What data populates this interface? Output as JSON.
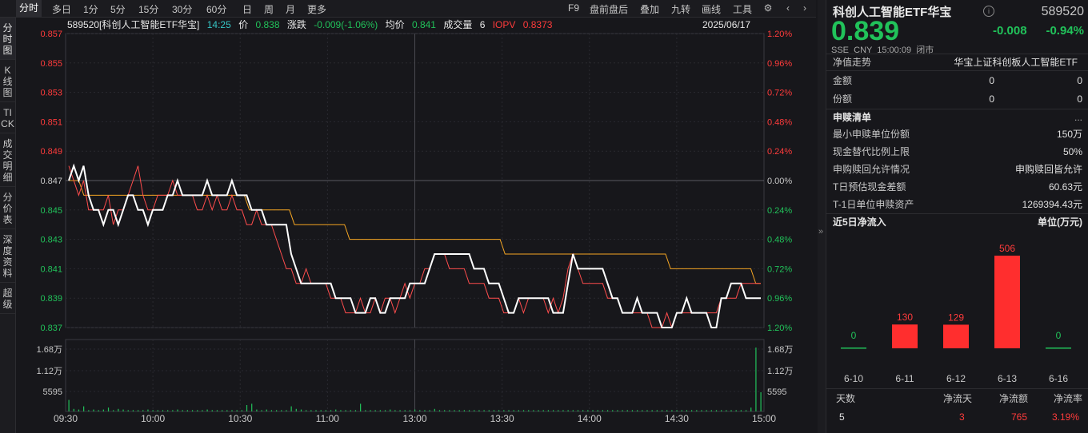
{
  "toolbar": {
    "tabs": [
      "分时",
      "多日",
      "1分",
      "5分",
      "15分",
      "30分",
      "60分",
      "日",
      "周",
      "月",
      "更多"
    ],
    "active_tab": "分时",
    "right_items": [
      "F9",
      "盘前盘后",
      "叠加",
      "九转",
      "画线",
      "工具"
    ]
  },
  "side_tabs": [
    "分时图",
    "K线图",
    "TICK",
    "成交明细",
    "分价表",
    "深度资料",
    "超级"
  ],
  "info": {
    "code_name": "589520[科创人工智能ETF华宝]",
    "time": "14:25",
    "price_label": "价",
    "price": "0.838",
    "change_label": "涨跌",
    "change": "-0.009(-1.06%)",
    "avg_label": "均价",
    "avg": "0.841",
    "volume_label": "成交量",
    "volume": "6",
    "iopv_label": "IOPV",
    "iopv": "0.8373",
    "date": "2025/06/17"
  },
  "chart_data": {
    "type": "line",
    "prev_close": 0.847,
    "x_ticks": [
      "09:30",
      "10:00",
      "10:30",
      "11:00",
      "13:00",
      "13:30",
      "14:00",
      "14:30",
      "15:00"
    ],
    "y_ticks_left": [
      "0.857",
      "0.855",
      "0.853",
      "0.851",
      "0.849",
      "0.847",
      "0.845",
      "0.843",
      "0.841",
      "0.839",
      "0.837"
    ],
    "y_ticks_right": [
      "1.20%",
      "0.96%",
      "0.72%",
      "0.48%",
      "0.24%",
      "0.00%",
      "0.24%",
      "0.48%",
      "0.72%",
      "0.96%",
      "1.20%"
    ],
    "ylim": [
      0.837,
      0.857
    ],
    "vol_ticks_left": [
      "1.68万",
      "1.12万",
      "5595"
    ],
    "vol_ticks_right": [
      "1.68万",
      "1.12万",
      "5595"
    ],
    "series": [
      {
        "name": "价",
        "color": "#ffffff",
        "values": [
          0.847,
          0.848,
          0.847,
          0.848,
          0.846,
          0.845,
          0.845,
          0.844,
          0.845,
          0.845,
          0.844,
          0.845,
          0.846,
          0.846,
          0.845,
          0.845,
          0.844,
          0.845,
          0.845,
          0.845,
          0.846,
          0.846,
          0.847,
          0.846,
          0.846,
          0.846,
          0.846,
          0.846,
          0.847,
          0.846,
          0.846,
          0.846,
          0.846,
          0.847,
          0.846,
          0.846,
          0.846,
          0.845,
          0.845,
          0.845,
          0.844,
          0.844,
          0.844,
          0.844,
          0.844,
          0.842,
          0.841,
          0.84,
          0.84,
          0.84,
          0.84,
          0.84,
          0.84,
          0.84,
          0.839,
          0.839,
          0.839,
          0.839,
          0.838,
          0.838,
          0.838,
          0.839,
          0.839,
          0.838,
          0.838,
          0.839,
          0.839,
          0.839,
          0.839,
          0.84,
          0.84,
          0.84,
          0.84,
          0.841,
          0.842,
          0.842,
          0.842,
          0.842,
          0.842,
          0.842,
          0.842,
          0.842,
          0.841,
          0.841,
          0.841,
          0.84,
          0.84,
          0.84,
          0.839,
          0.838,
          0.838,
          0.839,
          0.839,
          0.839,
          0.839,
          0.839,
          0.839,
          0.839,
          0.838,
          0.838,
          0.838,
          0.84,
          0.842,
          0.841,
          0.841,
          0.841,
          0.841,
          0.841,
          0.841,
          0.84,
          0.839,
          0.839,
          0.838,
          0.838,
          0.838,
          0.839,
          0.838,
          0.838,
          0.838,
          0.838,
          0.837,
          0.837,
          0.837,
          0.838,
          0.838,
          0.839,
          0.838,
          0.838,
          0.838,
          0.838,
          0.837,
          0.837,
          0.839,
          0.839,
          0.84,
          0.84,
          0.84,
          0.839,
          0.839,
          0.839,
          0.839
        ]
      },
      {
        "name": "均价",
        "color": "#f5a623",
        "values": [
          0.847,
          0.847,
          0.847,
          0.846,
          0.846,
          0.846,
          0.846,
          0.846,
          0.846,
          0.846,
          0.846,
          0.846,
          0.846,
          0.846,
          0.846,
          0.846,
          0.846,
          0.846,
          0.846,
          0.846,
          0.846,
          0.846,
          0.846,
          0.846,
          0.846,
          0.846,
          0.846,
          0.846,
          0.846,
          0.846,
          0.846,
          0.846,
          0.846,
          0.846,
          0.846,
          0.846,
          0.845,
          0.845,
          0.845,
          0.845,
          0.845,
          0.845,
          0.845,
          0.845,
          0.845,
          0.844,
          0.844,
          0.844,
          0.844,
          0.844,
          0.844,
          0.844,
          0.844,
          0.844,
          0.844,
          0.844,
          0.843,
          0.843,
          0.843,
          0.843,
          0.843,
          0.843,
          0.843,
          0.843,
          0.843,
          0.843,
          0.843,
          0.843,
          0.843,
          0.843,
          0.843,
          0.843,
          0.843,
          0.843,
          0.843,
          0.843,
          0.843,
          0.843,
          0.843,
          0.843,
          0.843,
          0.843,
          0.843,
          0.843,
          0.843,
          0.843,
          0.843,
          0.842,
          0.842,
          0.842,
          0.842,
          0.842,
          0.842,
          0.842,
          0.842,
          0.842,
          0.842,
          0.842,
          0.842,
          0.842,
          0.842,
          0.842,
          0.842,
          0.842,
          0.842,
          0.842,
          0.842,
          0.842,
          0.842,
          0.842,
          0.842,
          0.842,
          0.842,
          0.842,
          0.842,
          0.842,
          0.842,
          0.842,
          0.842,
          0.842,
          0.841,
          0.841,
          0.841,
          0.841,
          0.841,
          0.841,
          0.841,
          0.841,
          0.841,
          0.841,
          0.841,
          0.841,
          0.841,
          0.841,
          0.841,
          0.841,
          0.841,
          0.84,
          0.84
        ]
      },
      {
        "name": "IOPV",
        "color": "#ff4d4d",
        "values": [
          0.848,
          0.847,
          0.846,
          0.847,
          0.845,
          0.845,
          0.845,
          0.845,
          0.846,
          0.844,
          0.845,
          0.845,
          0.846,
          0.847,
          0.848,
          0.846,
          0.845,
          0.845,
          0.846,
          0.846,
          0.846,
          0.847,
          0.846,
          0.846,
          0.846,
          0.846,
          0.845,
          0.845,
          0.846,
          0.845,
          0.846,
          0.845,
          0.845,
          0.846,
          0.845,
          0.845,
          0.844,
          0.844,
          0.845,
          0.844,
          0.844,
          0.844,
          0.843,
          0.842,
          0.841,
          0.841,
          0.84,
          0.84,
          0.841,
          0.84,
          0.84,
          0.84,
          0.84,
          0.839,
          0.839,
          0.839,
          0.838,
          0.838,
          0.838,
          0.839,
          0.838,
          0.838,
          0.839,
          0.838,
          0.839,
          0.839,
          0.838,
          0.839,
          0.84,
          0.839,
          0.84,
          0.84,
          0.841,
          0.841,
          0.842,
          0.842,
          0.842,
          0.841,
          0.841,
          0.841,
          0.841,
          0.84,
          0.84,
          0.84,
          0.84,
          0.839,
          0.839,
          0.839,
          0.838,
          0.838,
          0.838,
          0.839,
          0.838,
          0.839,
          0.839,
          0.839,
          0.839,
          0.838,
          0.839,
          0.838,
          0.839,
          0.841,
          0.842,
          0.841,
          0.84,
          0.84,
          0.84,
          0.84,
          0.84,
          0.839,
          0.839,
          0.839,
          0.838,
          0.838,
          0.838,
          0.838,
          0.838,
          0.838,
          0.837,
          0.837,
          0.837,
          0.838,
          0.837,
          0.838,
          0.838,
          0.838,
          0.838,
          0.838,
          0.838,
          0.838,
          0.838,
          0.838,
          0.839,
          0.839,
          0.839,
          0.839,
          0.84,
          0.84,
          0.84,
          0.84,
          0.84
        ]
      }
    ],
    "volume": [
      18,
      4,
      3,
      8,
      2,
      3,
      2,
      3,
      6,
      2,
      4,
      3,
      2,
      2,
      2,
      2,
      3,
      2,
      2,
      2,
      2,
      2,
      3,
      2,
      2,
      2,
      2,
      2,
      3,
      2,
      2,
      2,
      2,
      2,
      2,
      2,
      10,
      12,
      3,
      2,
      3,
      2,
      2,
      2,
      2,
      8,
      4,
      3,
      2,
      2,
      2,
      2,
      2,
      2,
      3,
      2,
      2,
      2,
      2,
      12,
      2,
      2,
      2,
      2,
      2,
      3,
      2,
      2,
      2,
      2,
      3,
      2,
      2,
      2,
      4,
      2,
      2,
      2,
      2,
      2,
      2,
      2,
      2,
      2,
      2,
      2,
      2,
      2,
      2,
      2,
      2,
      2,
      2,
      2,
      2,
      2,
      2,
      2,
      2,
      2,
      2,
      2,
      2,
      2,
      2,
      2,
      2,
      2,
      2,
      2,
      2,
      2,
      2,
      2,
      2,
      2,
      2,
      2,
      2,
      2,
      2,
      2,
      2,
      2,
      2,
      2,
      2,
      2,
      2,
      2,
      2,
      2,
      2,
      2,
      2,
      2,
      2,
      2,
      6,
      100,
      30
    ]
  },
  "panel": {
    "title": "科创人工智能ETF华宝",
    "code": "589520",
    "price": "0.839",
    "change": "-0.008",
    "change_pct": "-0.94%",
    "meta": "SSE  CNY  15:00:09  闭市",
    "nav_label": "净值走势",
    "nav_value": "华宝上证科创板人工智能ETF",
    "rows1": [
      {
        "label": "金额",
        "v1": "0",
        "v2": "0"
      },
      {
        "label": "份额",
        "v1": "0",
        "v2": "0"
      }
    ],
    "section_sub": "申赎清单",
    "rows2": [
      {
        "label": "最小申赎单位份额",
        "value": "150万"
      },
      {
        "label": "现金替代比例上限",
        "value": "50%"
      },
      {
        "label": "申购赎回允许情况",
        "value": "申购赎回皆允许"
      },
      {
        "label": "T日预估现金差额",
        "value": "60.63元"
      },
      {
        "label": "T-1日单位申赎资产",
        "value": "1269394.43元"
      }
    ],
    "flow_title": "近5日净流入",
    "flow_unit": "单位(万元)",
    "flow_bars": {
      "categories": [
        "6-10",
        "6-11",
        "6-12",
        "6-13",
        "6-16"
      ],
      "values": [
        0,
        130,
        129,
        506,
        0
      ]
    },
    "summary_headers": [
      "天数",
      "净流天",
      "净流额",
      "净流率"
    ],
    "summary_values": [
      "5",
      "3",
      "765",
      "3.19%"
    ]
  },
  "colors": {
    "up": "#ff3b3b",
    "down": "#21c25a",
    "bg": "#17171b"
  }
}
